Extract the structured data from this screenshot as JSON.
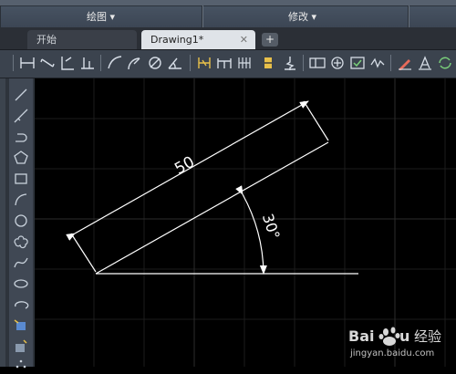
{
  "ribbon": {
    "panels": [
      {
        "label": "绘图 ▾"
      },
      {
        "label": "修改 ▾"
      }
    ]
  },
  "tabs": {
    "start": {
      "label": "开始"
    },
    "drawing": {
      "label": "Drawing1*",
      "close": "✕"
    },
    "add": "+"
  },
  "drawing": {
    "linear_dimension": "50",
    "angular_dimension": "30°"
  },
  "watermark": {
    "url": "jingyan.baidu.com"
  }
}
